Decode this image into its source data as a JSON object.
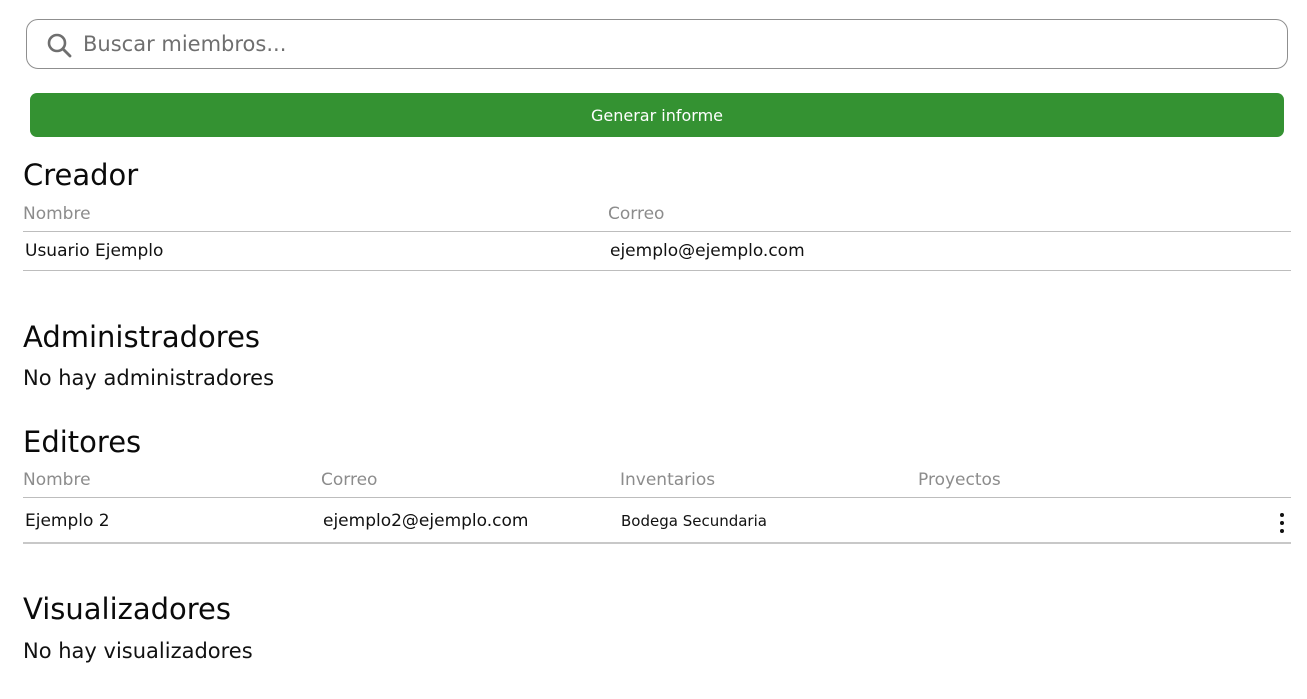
{
  "search": {
    "placeholder": "Buscar miembros...",
    "value": ""
  },
  "actions": {
    "report_label": "Generar informe"
  },
  "creator": {
    "title": "Creador",
    "columns": [
      "Nombre",
      "Correo"
    ],
    "rows": [
      {
        "name": "Usuario Ejemplo",
        "email": "ejemplo@ejemplo.com"
      }
    ]
  },
  "admins": {
    "title": "Administradores",
    "empty": "No hay administradores"
  },
  "editors": {
    "title": "Editores",
    "columns": [
      "Nombre",
      "Correo",
      "Inventarios",
      "Proyectos"
    ],
    "rows": [
      {
        "name": "Ejemplo 2",
        "email": "ejemplo2@ejemplo.com",
        "inventories": "Bodega Secundaria",
        "projects": ""
      }
    ]
  },
  "viewers": {
    "title": "Visualizadores",
    "empty": "No hay visualizadores"
  },
  "colors": {
    "accent": "#349232",
    "muted": "#8c8c8c"
  },
  "icons": {
    "search": "search-icon",
    "more": "more-vertical-icon"
  }
}
